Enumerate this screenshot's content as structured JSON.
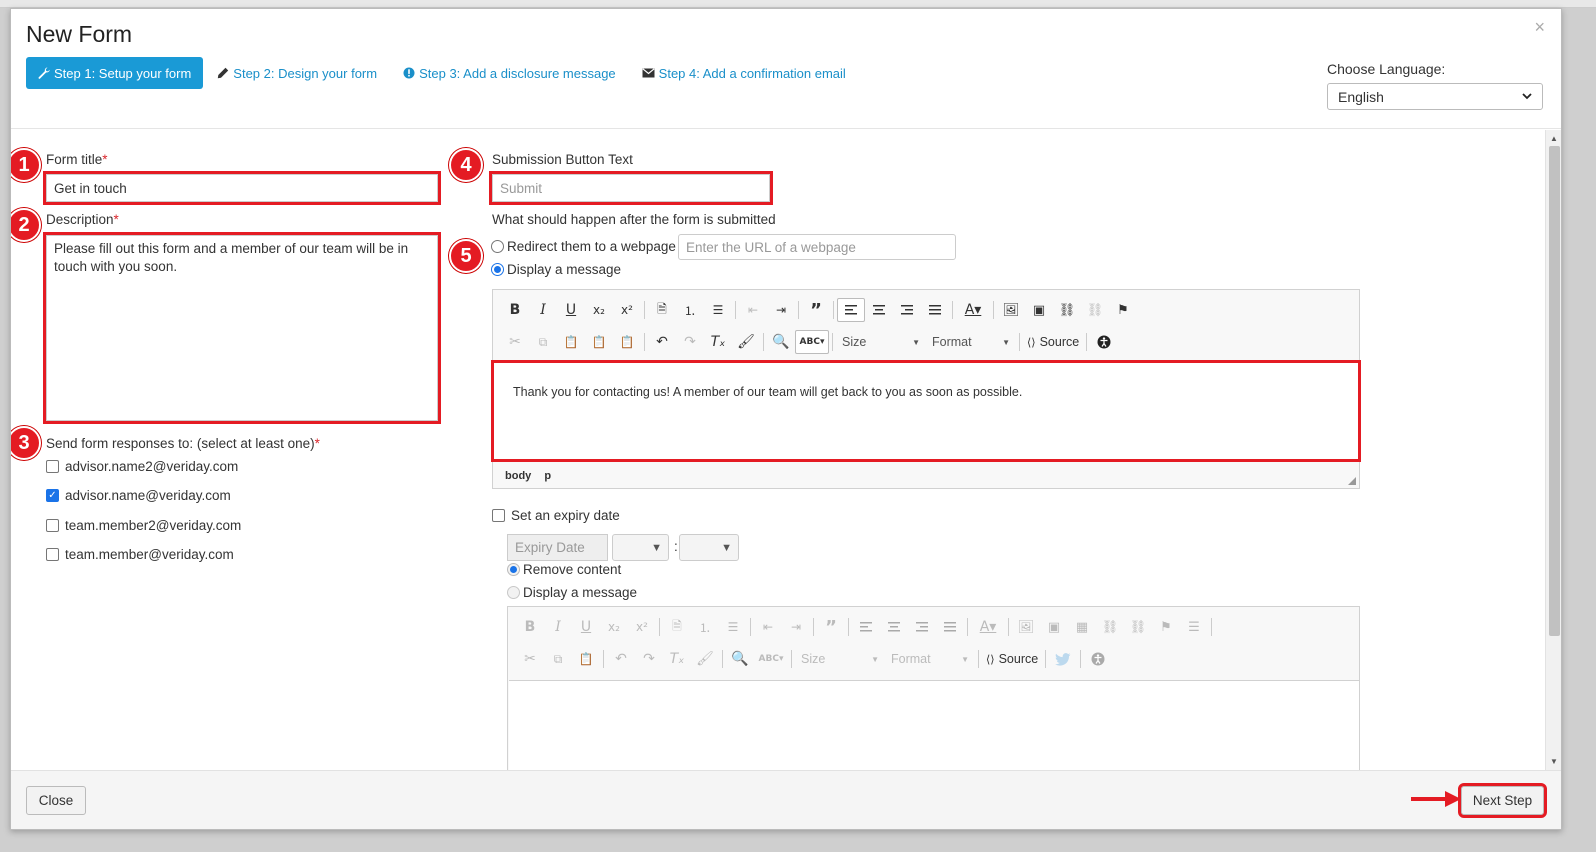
{
  "modal": {
    "title": "New Form",
    "close_symbol": "×"
  },
  "steps": [
    {
      "label": "Step 1: Setup your form",
      "icon": "wrench-icon",
      "active": true
    },
    {
      "label": "Step 2: Design your form",
      "icon": "pencil-icon",
      "active": false
    },
    {
      "label": "Step 3: Add a disclosure message",
      "icon": "exclamation-circle-icon",
      "active": false
    },
    {
      "label": "Step 4: Add a confirmation email",
      "icon": "envelope-icon",
      "active": false
    }
  ],
  "language": {
    "label": "Choose Language:",
    "value": "English"
  },
  "annotations": [
    "1",
    "2",
    "3",
    "4",
    "5"
  ],
  "form_title": {
    "label": "Form title",
    "required": "*",
    "value": "Get in touch"
  },
  "description": {
    "label": "Description",
    "required": "*",
    "value": "Please fill out this form and a member of our team will be in touch with you soon."
  },
  "recipients": {
    "label": "Send form responses to: (select at least one)",
    "required": "*",
    "items": [
      {
        "email": "advisor.name2@veriday.com",
        "checked": false
      },
      {
        "email": "advisor.name@veriday.com",
        "checked": true
      },
      {
        "email": "team.member2@veriday.com",
        "checked": false
      },
      {
        "email": "team.member@veriday.com",
        "checked": false
      }
    ]
  },
  "submit_button": {
    "label": "Submission Button Text",
    "placeholder": "Submit"
  },
  "after_submit": {
    "label": "What should happen after the form is submitted",
    "redirect_label": "Redirect them to a webpage",
    "url_placeholder": "Enter the URL of a webpage",
    "display_label": "Display a message",
    "selected": "display"
  },
  "editor1": {
    "size_label": "Size",
    "format_label": "Format",
    "source_label": "Source",
    "content": "Thank you for contacting us! A member of our team will get back to you as soon as possible.",
    "path": [
      "body",
      "p"
    ]
  },
  "expiry": {
    "checkbox_label": "Set an expiry date",
    "date_placeholder": "Expiry Date",
    "time_separator": ":",
    "remove_label": "Remove content",
    "display_label": "Display a message"
  },
  "editor2": {
    "size_label": "Size",
    "format_label": "Format",
    "source_label": "Source"
  },
  "footer": {
    "close_label": "Close",
    "next_label": "Next Step"
  },
  "colors": {
    "accent": "#1a9ad6",
    "link": "#1a8fc9",
    "highlight": "#e41b23",
    "required": "#d9262c"
  }
}
